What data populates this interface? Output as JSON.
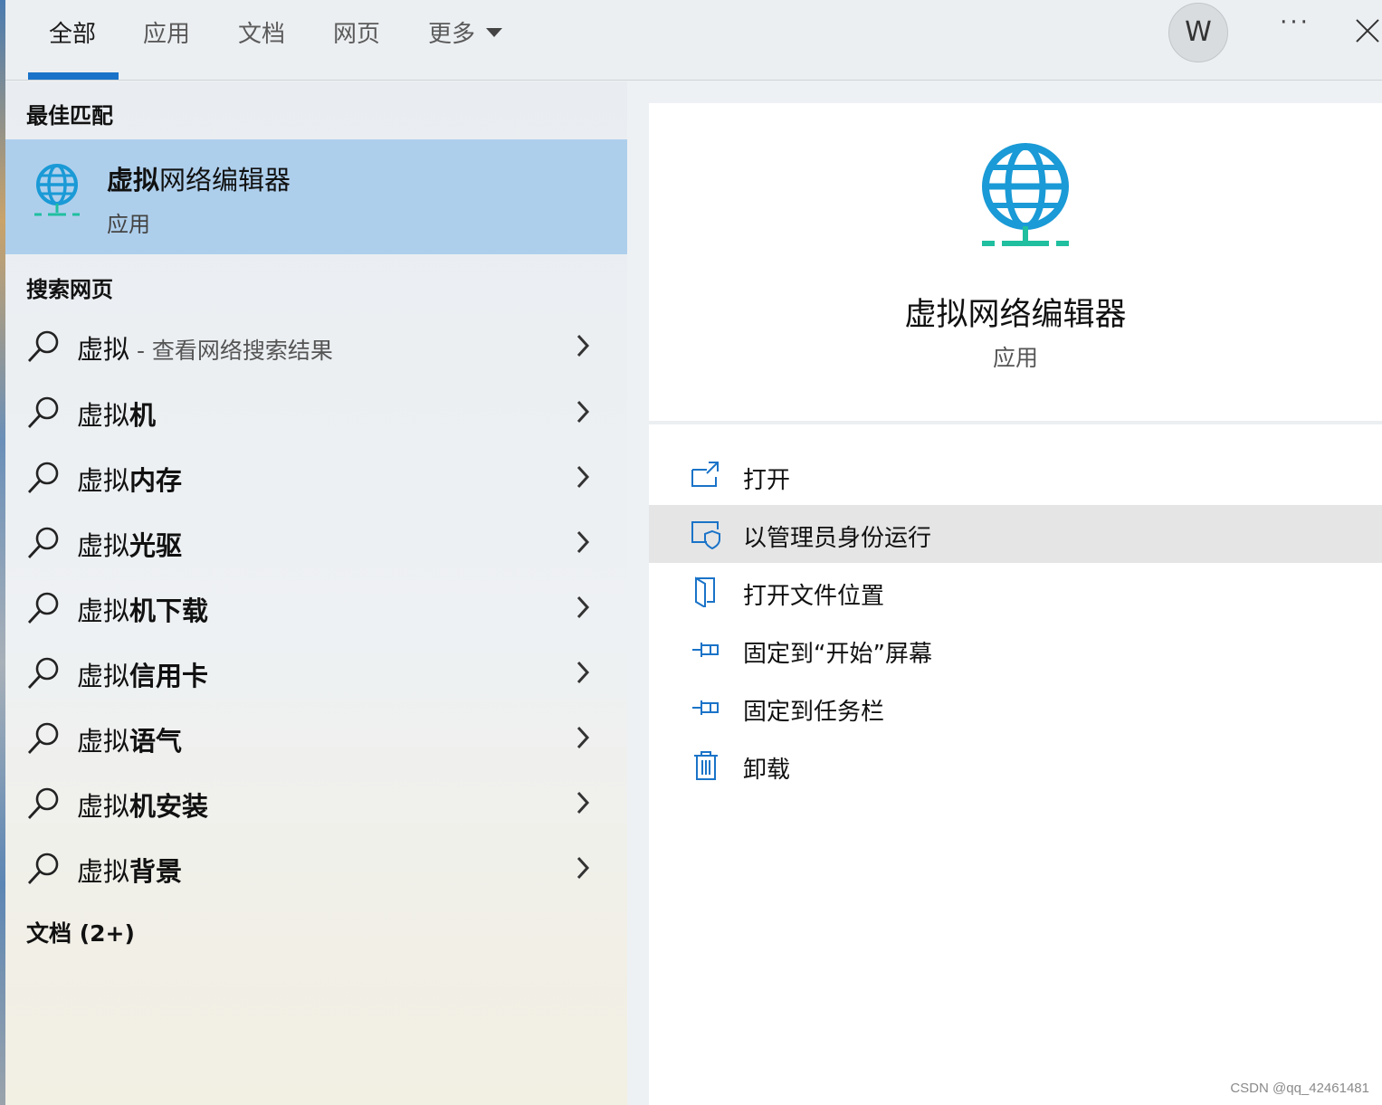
{
  "tabs": [
    {
      "label": "全部",
      "active": true
    },
    {
      "label": "应用"
    },
    {
      "label": "文档"
    },
    {
      "label": "网页"
    },
    {
      "label": "更多"
    }
  ],
  "header": {
    "avatar_letter": "W",
    "more_label": "···"
  },
  "best_match": {
    "section_title": "最佳匹配",
    "title_bold": "虚拟",
    "title_rest": "网络编辑器",
    "subtitle": "应用",
    "icon": "globe-network-icon"
  },
  "web_search": {
    "section_title": "搜索网页",
    "items": [
      {
        "prefix": "虚拟",
        "bold": "",
        "hint": " - 查看网络搜索结果"
      },
      {
        "prefix": "虚拟",
        "bold": "机",
        "hint": ""
      },
      {
        "prefix": "虚拟",
        "bold": "内存",
        "hint": ""
      },
      {
        "prefix": "虚拟",
        "bold": "光驱",
        "hint": ""
      },
      {
        "prefix": "虚拟",
        "bold": "机下载",
        "hint": ""
      },
      {
        "prefix": "虚拟",
        "bold": "信用卡",
        "hint": ""
      },
      {
        "prefix": "虚拟",
        "bold": "语气",
        "hint": ""
      },
      {
        "prefix": "虚拟",
        "bold": "机安装",
        "hint": ""
      },
      {
        "prefix": "虚拟",
        "bold": "背景",
        "hint": ""
      }
    ]
  },
  "documents": {
    "section_title": "文档 (2+)"
  },
  "detail": {
    "title": "虚拟网络编辑器",
    "subtitle": "应用",
    "actions": [
      {
        "label": "打开",
        "icon": "open-window-icon"
      },
      {
        "label": "以管理员身份运行",
        "icon": "shield-admin-icon"
      },
      {
        "label": "打开文件位置",
        "icon": "folder-location-icon"
      },
      {
        "label": "固定到“开始”屏幕",
        "icon": "pin-icon"
      },
      {
        "label": "固定到任务栏",
        "icon": "pin-icon"
      },
      {
        "label": "卸载",
        "icon": "trash-icon"
      }
    ]
  },
  "colors": {
    "accent": "#1a73c8",
    "selected_bg": "#aecfec",
    "globe_blue": "#1a9ad6",
    "globe_teal": "#1fbf9f",
    "hover_bg": "#e5e5e5"
  },
  "watermark": "CSDN @qq_42461481"
}
